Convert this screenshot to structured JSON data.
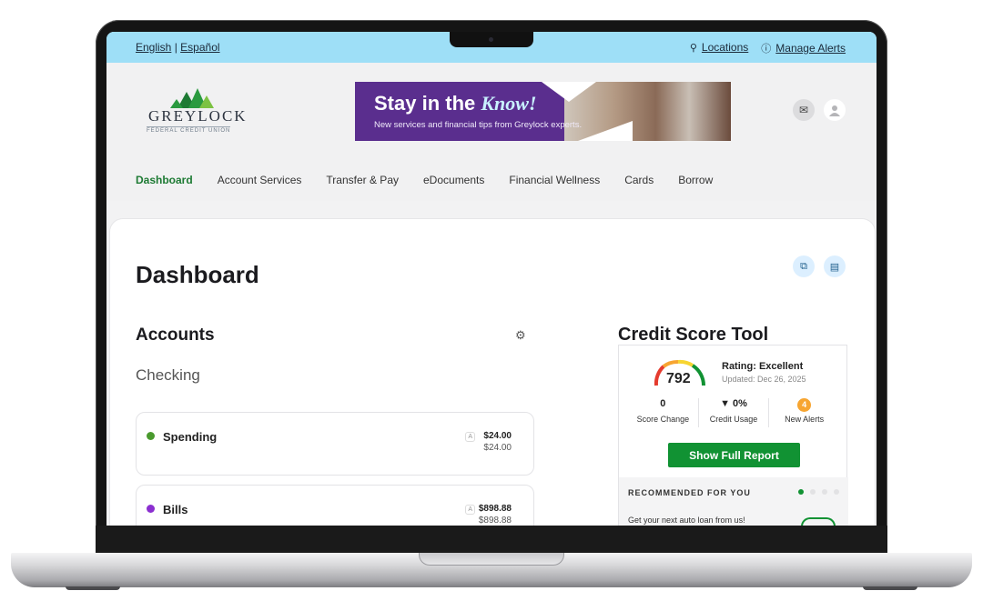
{
  "utility": {
    "english": "English",
    "sep": "|",
    "espanol": "Español",
    "locations": "Locations",
    "manage_alerts": "Manage Alerts"
  },
  "logo": {
    "name": "GREYLOCK",
    "sub": "FEDERAL CREDIT UNION"
  },
  "banner": {
    "title_prefix": "Stay in the",
    "title_script": "Know!",
    "subtitle": "New services and financial tips from Greylock experts."
  },
  "nav": {
    "items": [
      "Dashboard",
      "Account Services",
      "Transfer & Pay",
      "eDocuments",
      "Financial Wellness",
      "Cards",
      "Borrow"
    ]
  },
  "page": {
    "title": "Dashboard"
  },
  "accounts": {
    "heading": "Accounts",
    "group": "Checking",
    "items": [
      {
        "name": "Spending",
        "badge": "A",
        "amount": "$24.00",
        "available": "$24.00",
        "dot_color": "#4a9a2e"
      },
      {
        "name": "Bills",
        "badge": "A",
        "amount": "$898.88",
        "available": "$898.88",
        "dot_color": "#8b2fd0"
      }
    ]
  },
  "credit": {
    "heading": "Credit Score Tool",
    "score": "792",
    "rating": "Rating: Excellent",
    "updated": "Updated: Dec 26, 2025",
    "stats": [
      {
        "value": "0",
        "label": "Score Change"
      },
      {
        "value": "▼ 0%",
        "label": "Credit Usage"
      },
      {
        "value": "4",
        "label": "New Alerts"
      }
    ],
    "button": "Show Full Report",
    "recommended": "RECOMMENDED FOR YOU",
    "rec_text": "Get your next auto loan from us!"
  },
  "colors": {
    "utility_bar": "#9edff7",
    "accent_green": "#119233",
    "banner_purple": "#5a2e8e"
  }
}
